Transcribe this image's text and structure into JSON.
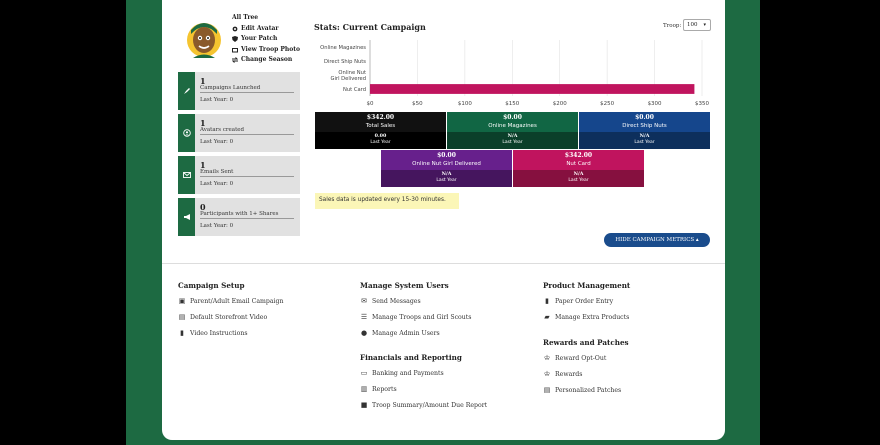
{
  "profile": {
    "links": [
      {
        "label": "All Tree",
        "icon": "none"
      },
      {
        "label": "Edit Avatar",
        "icon": "gear-icon"
      },
      {
        "label": "Your Patch",
        "icon": "shield-icon"
      },
      {
        "label": "View Troop Photo",
        "icon": "image-icon"
      },
      {
        "label": "Change Season",
        "icon": "swap-icon"
      }
    ]
  },
  "stats_boxes": [
    {
      "value": "1",
      "label": "Campaigns Launched",
      "last_year": "Last Year: 0",
      "icon": "rocket-icon"
    },
    {
      "value": "1",
      "label": "Avatars created",
      "last_year": "Last Year: 0",
      "icon": "user-circle-icon"
    },
    {
      "value": "1",
      "label": "Emails Sent",
      "last_year": "Last Year: 0",
      "icon": "envelope-icon"
    },
    {
      "value": "0",
      "label": "Participants with 1+ Shares",
      "last_year": "Last Year: 0",
      "icon": "megaphone-icon"
    }
  ],
  "stats_header": {
    "title": "Stats: Current Campaign",
    "troop_label": "Troop:",
    "troop_value": "100"
  },
  "chart_data": {
    "type": "bar",
    "orientation": "horizontal",
    "categories": [
      "Online Magazines",
      "Direct Ship Nuts",
      "Online Nut Girl Delivered",
      "Nut Card"
    ],
    "values": [
      0,
      0,
      0,
      342
    ],
    "xlim": [
      0,
      350
    ],
    "xticks": [
      "$0",
      "$50",
      "$100",
      "$150",
      "$200",
      "$250",
      "$300",
      "$350"
    ],
    "bar_color": "#c0145e",
    "grid": true
  },
  "tiles": [
    {
      "value": "$342.00",
      "name": "Total Sales",
      "last": "0.00",
      "last_label": "Last Year",
      "color": "#111111",
      "dark": "#000000"
    },
    {
      "value": "$0.00",
      "name": "Online Magazines",
      "last": "N/A",
      "last_label": "Last Year",
      "color": "#116644",
      "dark": "#0b3f2a"
    },
    {
      "value": "$0.00",
      "name": "Direct Ship Nuts",
      "last": "N/A",
      "last_label": "Last Year",
      "color": "#15468c",
      "dark": "#0d2f5c"
    },
    {
      "value": "$0.00",
      "name": "Online Nut Girl Delivered",
      "last": "N/A",
      "last_label": "Last Year",
      "color": "#67208c",
      "dark": "#45155e"
    },
    {
      "value": "$342.00",
      "name": "Nut Card",
      "last": "N/A",
      "last_label": "Last Year",
      "color": "#c0145e",
      "dark": "#86103f"
    }
  ],
  "notice": "Sales data is updated every 15-30 minutes.",
  "hide_button": "HIDE CAMPAIGN METRICS ▴",
  "menu": {
    "campaign_setup": {
      "title": "Campaign Setup",
      "items": [
        {
          "label": "Parent/Adult Email Campaign",
          "icon": "user-badge-icon"
        },
        {
          "label": "Default Storefront Video",
          "icon": "film-icon"
        },
        {
          "label": "Video Instructions",
          "icon": "file-icon"
        }
      ]
    },
    "system_users": {
      "title": "Manage System Users",
      "items": [
        {
          "label": "Send Messages",
          "icon": "envelope-icon"
        },
        {
          "label": "Manage Troops and Girl Scouts",
          "icon": "list-icon"
        },
        {
          "label": "Manage Admin Users",
          "icon": "users-icon"
        }
      ]
    },
    "financials": {
      "title": "Financials and Reporting",
      "items": [
        {
          "label": "Banking and Payments",
          "icon": "card-icon"
        },
        {
          "label": "Reports",
          "icon": "chart-icon"
        },
        {
          "label": "Troop Summary/Amount Due Report",
          "icon": "folder-icon"
        }
      ]
    },
    "product": {
      "title": "Product Management",
      "items": [
        {
          "label": "Paper Order Entry",
          "icon": "file-icon"
        },
        {
          "label": "Manage Extra Products",
          "icon": "cart-icon"
        }
      ]
    },
    "rewards": {
      "title": "Rewards and Patches",
      "items": [
        {
          "label": "Reward Opt-Out",
          "icon": "trophy-icon"
        },
        {
          "label": "Rewards",
          "icon": "trophy-icon"
        },
        {
          "label": "Personalized Patches",
          "icon": "doc-icon"
        }
      ]
    }
  }
}
